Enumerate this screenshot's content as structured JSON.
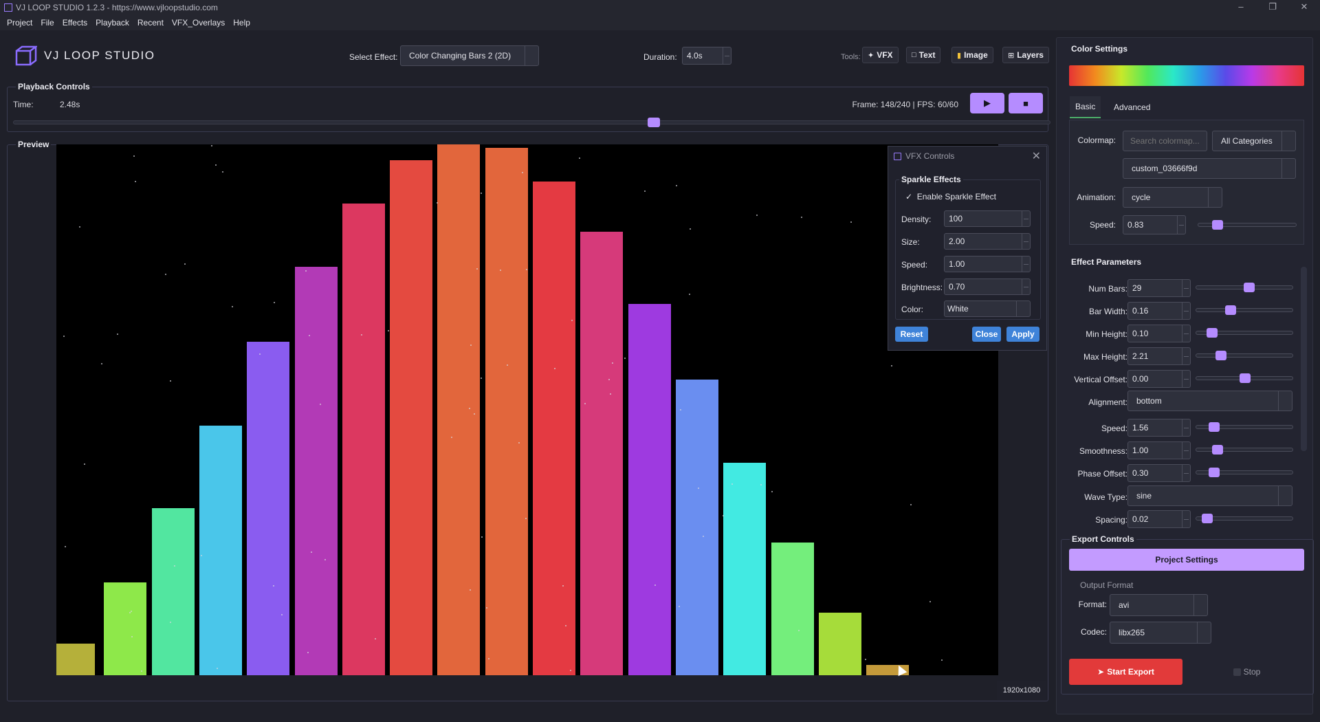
{
  "window": {
    "title": "VJ LOOP STUDIO 1.2.3 - https://www.vjloopstudio.com"
  },
  "menu": [
    "Project",
    "File",
    "Effects",
    "Playback",
    "Recent",
    "VFX_Overlays",
    "Help"
  ],
  "header": {
    "logo": "VJ LOOP STUDIO",
    "select_effect_label": "Select Effect:",
    "select_effect_value": "Color Changing Bars 2 (2D)",
    "duration_label": "Duration:",
    "duration_value": "4.0s",
    "tools_label": "Tools:",
    "tools": [
      {
        "label": "VFX",
        "icon": "sparkle-icon"
      },
      {
        "label": "Text",
        "icon": "document-icon"
      },
      {
        "label": "Image",
        "icon": "image-icon"
      },
      {
        "label": "Layers",
        "icon": "grid-icon"
      }
    ]
  },
  "playback": {
    "title": "Playback Controls",
    "time_label": "Time:",
    "time_value": "2.48s",
    "frame_info": "Frame: 148/240 | FPS: 60/60",
    "frame": 148,
    "total_frames": 240,
    "play_symbol": "▶",
    "stop_symbol": "■"
  },
  "preview": {
    "title": "Preview",
    "resolution": "1920x1080",
    "bars": [
      {
        "color": "#b5b03a",
        "height": 0.06
      },
      {
        "color": "#8ee84a",
        "height": 0.175
      },
      {
        "color": "#52e6a0",
        "height": 0.315
      },
      {
        "color": "#4ac6ea",
        "height": 0.47
      },
      {
        "color": "#8a5cf0",
        "height": 0.628
      },
      {
        "color": "#b23ab6",
        "height": 0.77
      },
      {
        "color": "#dc3860",
        "height": 0.888
      },
      {
        "color": "#e44a40",
        "height": 0.97
      },
      {
        "color": "#e2663c",
        "height": 1.0
      },
      {
        "color": "#e2663c",
        "height": 0.993
      },
      {
        "color": "#e43a42",
        "height": 0.93
      },
      {
        "color": "#d63a7a",
        "height": 0.835
      },
      {
        "color": "#9e3ae0",
        "height": 0.7
      },
      {
        "color": "#6a8ef0",
        "height": 0.557
      },
      {
        "color": "#42eae2",
        "height": 0.4
      },
      {
        "color": "#74ee7c",
        "height": 0.25
      },
      {
        "color": "#a6dc3a",
        "height": 0.118
      },
      {
        "color": "#c49a3a",
        "height": 0.02
      }
    ]
  },
  "vfx_dialog": {
    "title": "VFX Controls",
    "close_symbol": "✕",
    "group_title": "Sparkle Effects",
    "enable_label": "Enable Sparkle Effect",
    "check_symbol": "✓",
    "density_label": "Density:",
    "density": "100",
    "size_label": "Size:",
    "size": "2.00",
    "speed_label": "Speed:",
    "speed": "1.00",
    "brightness_label": "Brightness:",
    "brightness": "0.70",
    "color_label": "Color:",
    "color": "White",
    "reset": "Reset",
    "close": "Close",
    "apply": "Apply"
  },
  "color_settings": {
    "title": "Color Settings",
    "tabs": [
      "Basic",
      "Advanced"
    ],
    "colormap_label": "Colormap:",
    "search_placeholder": "Search colormap...",
    "category": "All Categories",
    "colormap": "custom_03666f9d",
    "animation_label": "Animation:",
    "animation": "cycle",
    "speed_label": "Speed:",
    "speed": "0.83",
    "speed_level": 0.16
  },
  "effect_params": {
    "title": "Effect Parameters",
    "params": [
      {
        "label": "Num Bars:",
        "value": "29",
        "level": 0.55
      },
      {
        "label": "Bar Width:",
        "value": "0.16",
        "level": 0.33
      },
      {
        "label": "Min Height:",
        "value": "0.10",
        "level": 0.12
      },
      {
        "label": "Max Height:",
        "value": "2.21",
        "level": 0.22
      },
      {
        "label": "Vertical Offset:",
        "value": "0.00",
        "level": 0.5
      }
    ],
    "alignment_label": "Alignment:",
    "alignment": "bottom",
    "params2": [
      {
        "label": "Speed:",
        "value": "1.56",
        "level": 0.14
      },
      {
        "label": "Smoothness:",
        "value": "1.00",
        "level": 0.18
      },
      {
        "label": "Phase Offset:",
        "value": "0.30",
        "level": 0.14
      }
    ],
    "wave_type_label": "Wave Type:",
    "wave_type": "sine",
    "spacing_label": "Spacing:",
    "spacing": "0.02",
    "spacing_level": 0.06
  },
  "export": {
    "title": "Export Controls",
    "project_settings": "Project Settings",
    "output_format": "Output Format",
    "format_label": "Format:",
    "format": "avi",
    "codec_label": "Codec:",
    "codec": "libx265",
    "start": "Start Export",
    "stop": "Stop"
  }
}
